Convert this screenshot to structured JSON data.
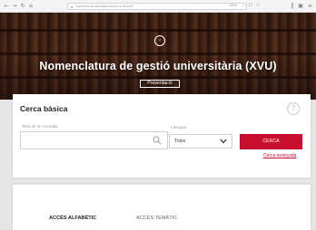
{
  "browser": {
    "url": "www.termcat.cat/ca/diccionaris-en-linia/95",
    "zoom": "100%",
    "icons": [
      "back-icon",
      "forward-icon",
      "reload-icon",
      "home-icon",
      "lock-icon",
      "more-icon",
      "bookmark-icon",
      "star-icon",
      "library-icon",
      "reader-icon",
      "menu-icon"
    ]
  },
  "hero": {
    "title": "Nomenclatura de gestió universitària (XVU)",
    "button": "Presentació"
  },
  "search": {
    "title": "Cerca bàsica",
    "help": "?",
    "query_label": "Text de la consulta",
    "query_value": "",
    "language_label": "Llengua",
    "language_value": "Totes",
    "button": "CERCA",
    "advanced_link": "Cerca avançada"
  },
  "access": {
    "tabs": [
      {
        "label": "ACCÉS ALFABÈTIC",
        "active": true
      },
      {
        "label": "ACCÉS TEMÀTIC",
        "active": false
      }
    ]
  },
  "colors": {
    "accent": "#c8102e",
    "page_bg": "#e6e6e6",
    "card_bg": "#ffffff"
  }
}
